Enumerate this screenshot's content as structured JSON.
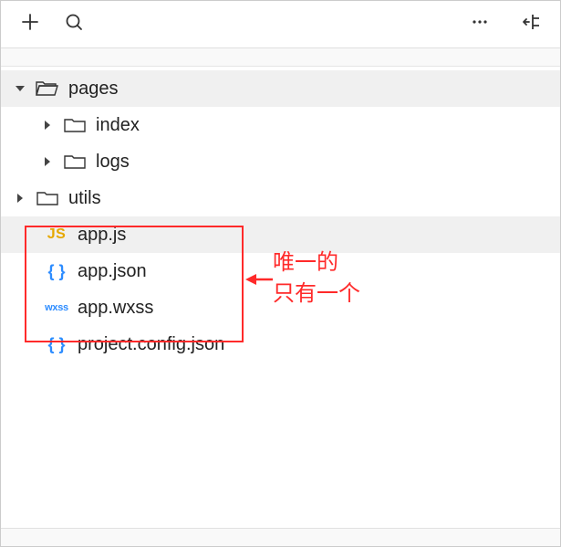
{
  "toolbar": {
    "add_icon": "plus",
    "search_icon": "search",
    "more_icon": "more",
    "collapse_icon": "collapse-panel"
  },
  "tree": {
    "root": {
      "pages": {
        "label": "pages",
        "expanded": true,
        "children": {
          "index": {
            "label": "index",
            "expanded": false
          },
          "logs": {
            "label": "logs",
            "expanded": false
          }
        }
      },
      "utils": {
        "label": "utils",
        "expanded": false
      },
      "app_js": {
        "label": "app.js",
        "icon": "JS",
        "selected": true
      },
      "app_json": {
        "label": "app.json",
        "icon": "{ }"
      },
      "app_wxss": {
        "label": "app.wxss",
        "icon": "wxss"
      },
      "project_config": {
        "label": "project.config.json",
        "icon": "{ }"
      }
    }
  },
  "annotation": {
    "line1": "唯一的",
    "line2": "只有一个"
  }
}
